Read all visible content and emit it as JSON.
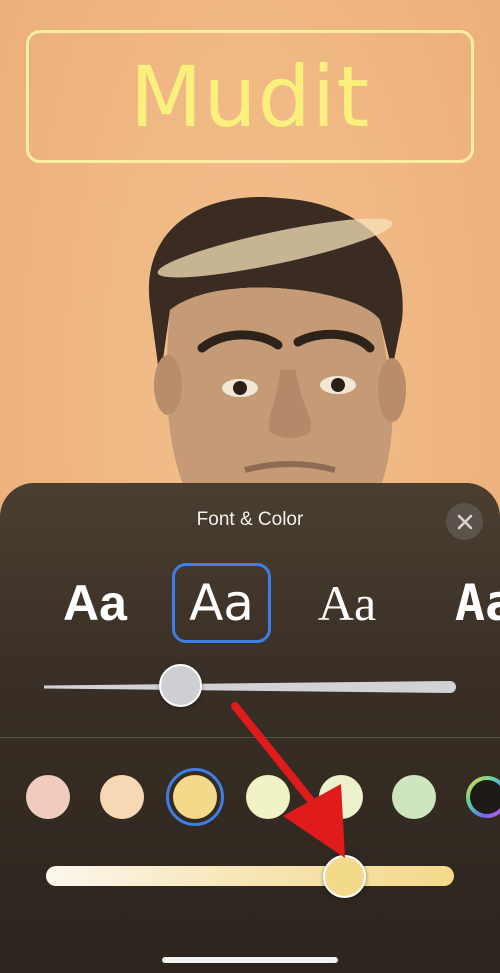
{
  "poster": {
    "name": "Mudit"
  },
  "sheet": {
    "title": "Font & Color",
    "close_icon": "xmark-icon"
  },
  "fonts": {
    "options": [
      "Aa",
      "Aa",
      "Aa",
      "Aa"
    ],
    "selected_index": 1,
    "weight_slider_value": 0.33
  },
  "colors": {
    "swatches": [
      "#f1cbbd",
      "#f6d9b4",
      "#f4d98a",
      "#f2f2c7",
      "#edf1cc",
      "#cfe5bf"
    ],
    "selected_index": 2,
    "tone_slider_value": 0.74,
    "accent": "#3f7ee6",
    "annotation_arrow": "#e01b1b"
  }
}
